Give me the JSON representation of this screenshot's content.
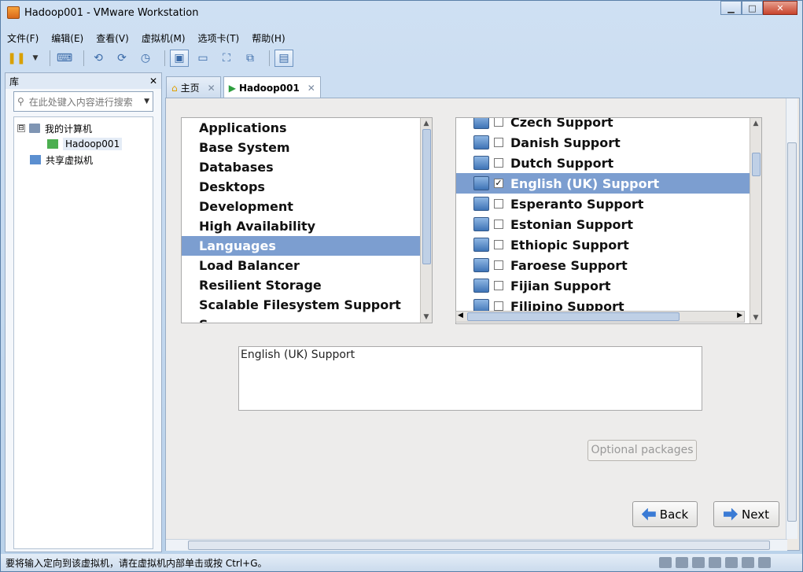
{
  "window": {
    "title": "Hadoop001 - VMware Workstation",
    "min_label": "▁",
    "max_label": "□",
    "close_label": "✕"
  },
  "menu": [
    "文件(F)",
    "编辑(E)",
    "查看(V)",
    "虚拟机(M)",
    "选项卡(T)",
    "帮助(H)"
  ],
  "toolbar": [
    "pause-icon",
    "dropdown-icon",
    "send-keys-icon",
    "snapshot-icon",
    "revert-icon",
    "manage-snapshots-icon",
    "console-view-icon",
    "fullscreen-icon",
    "unity-icon",
    "quick-switch-icon",
    "thumbnail-icon"
  ],
  "library": {
    "title": "库",
    "close": "✕",
    "search_placeholder": "在此处键入内容进行搜索",
    "tree": [
      {
        "label": "我的计算机",
        "expander": "⊟"
      },
      {
        "label": "Hadoop001"
      },
      {
        "label": "共享虚拟机"
      }
    ]
  },
  "tabs": [
    {
      "label": "主页",
      "close": "✕"
    },
    {
      "label": "Hadoop001",
      "close": "✕"
    }
  ],
  "categories": [
    "Applications",
    "Base System",
    "Databases",
    "Desktops",
    "Development",
    "High Availability",
    "Languages",
    "Load Balancer",
    "Resilient Storage",
    "Scalable Filesystem Support",
    "S..."
  ],
  "packages": [
    {
      "label": "Czech Support",
      "checked": false
    },
    {
      "label": "Danish Support",
      "checked": false
    },
    {
      "label": "Dutch Support",
      "checked": false
    },
    {
      "label": "English (UK) Support",
      "checked": true
    },
    {
      "label": "Esperanto Support",
      "checked": false
    },
    {
      "label": "Estonian Support",
      "checked": false
    },
    {
      "label": "Ethiopic Support",
      "checked": false
    },
    {
      "label": "Faroese Support",
      "checked": false
    },
    {
      "label": "Fijian Support",
      "checked": false
    },
    {
      "label": "Filipino Support",
      "checked": false
    }
  ],
  "description": "English (UK) Support",
  "buttons": {
    "optional": "Optional packages",
    "back": "Back",
    "next": "Next"
  },
  "status": "要将输入定向到该虚拟机，请在虚拟机内部单击或按 Ctrl+G。"
}
